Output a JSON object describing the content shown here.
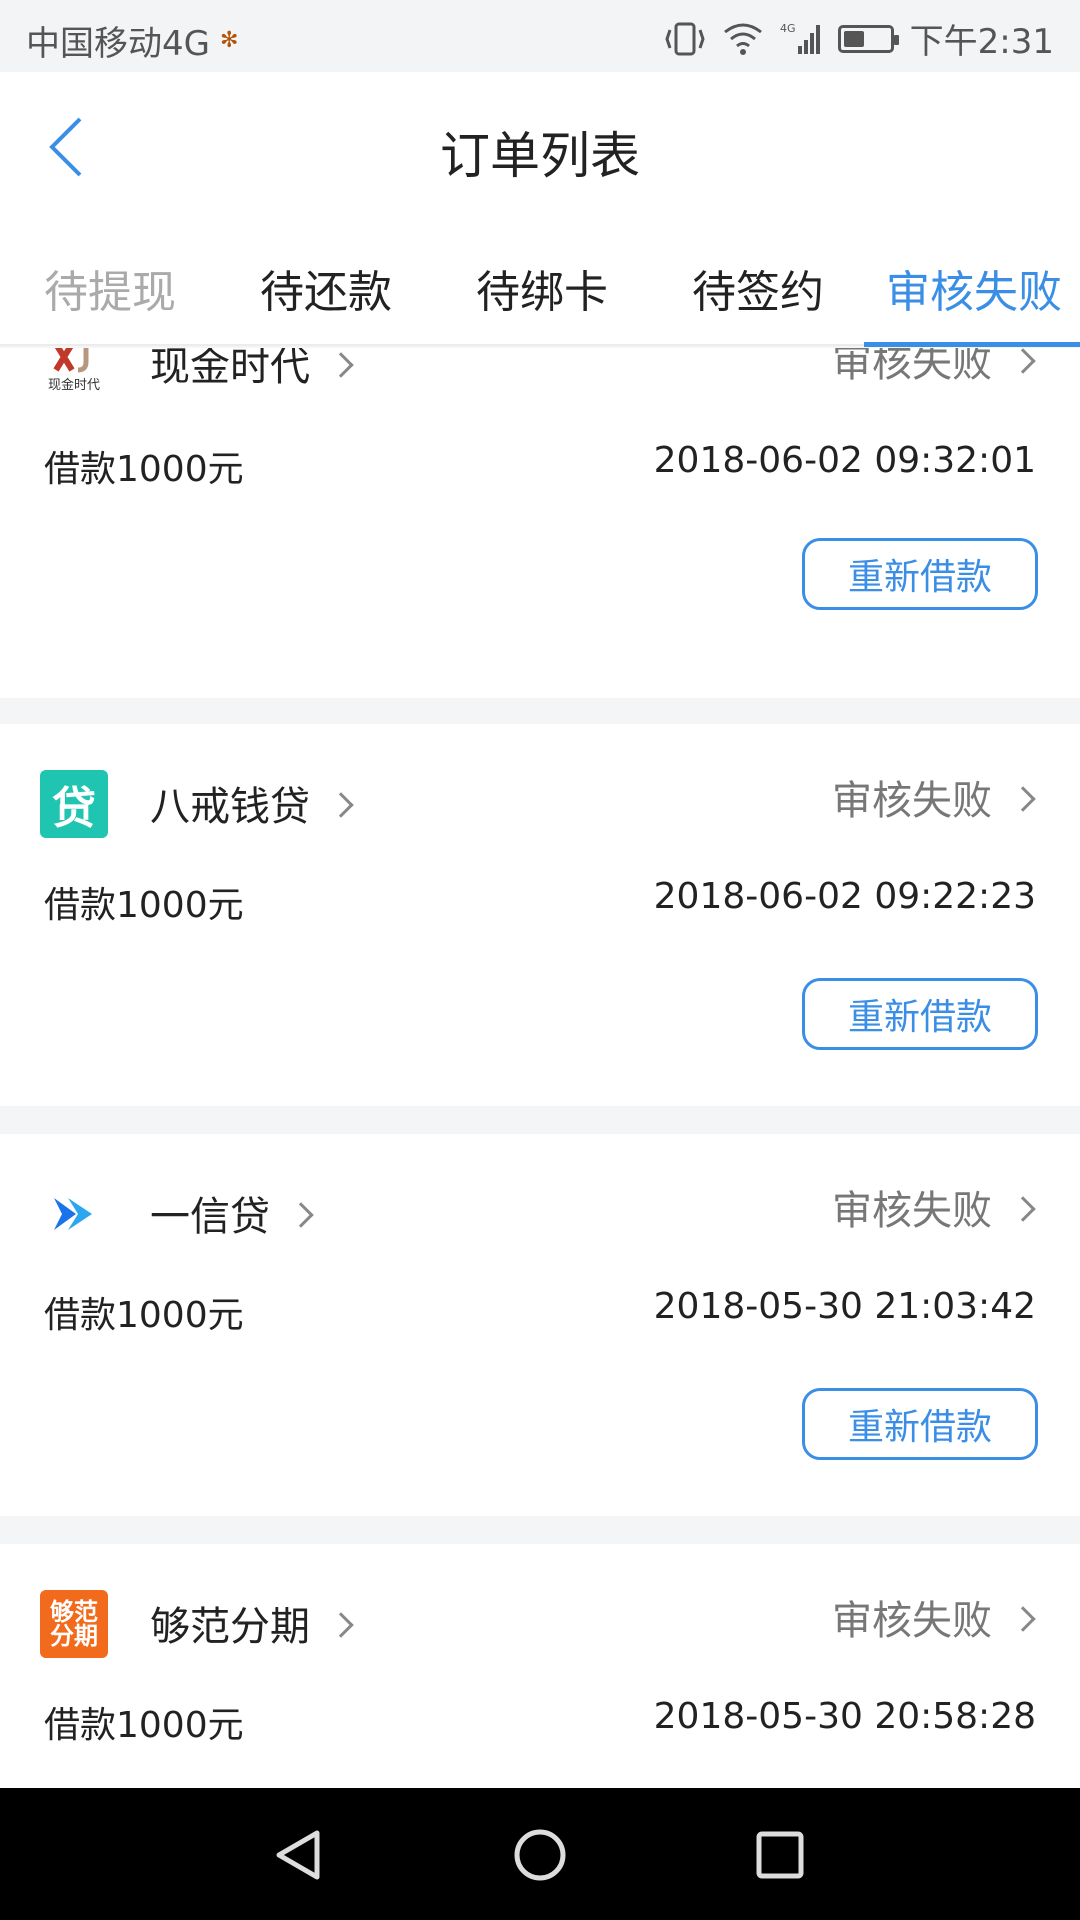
{
  "statusbar": {
    "carrier": "中国移动4G",
    "time": "下午2:31",
    "network_label": "4G"
  },
  "header": {
    "title": "订单列表"
  },
  "tabs": [
    {
      "label": "待提现"
    },
    {
      "label": "待还款"
    },
    {
      "label": "待绑卡"
    },
    {
      "label": "待签约"
    },
    {
      "label": "审核失败",
      "active": true
    }
  ],
  "orders": [
    {
      "lender": "现金时代",
      "logo_text": "现金时代",
      "status": "审核失败",
      "loan": "借款1000元",
      "date": "2018-06-02 09:32:01",
      "button": "重新借款"
    },
    {
      "lender": "八戒钱贷",
      "logo_text": "贷",
      "status": "审核失败",
      "loan": "借款1000元",
      "date": "2018-06-02 09:22:23",
      "button": "重新借款"
    },
    {
      "lender": "一信贷",
      "status": "审核失败",
      "loan": "借款1000元",
      "date": "2018-05-30 21:03:42",
      "button": "重新借款"
    },
    {
      "lender": "够范分期",
      "logo_text_1": "够范",
      "logo_text_2": "分期",
      "status": "审核失败",
      "loan": "借款1000元",
      "date": "2018-05-30 20:58:28"
    }
  ],
  "colors": {
    "accent": "#3a8ee6",
    "logo_bajie": "#1fc5b0",
    "logo_goufan": "#f26a1b",
    "logo_yixin": "#1a73e8"
  }
}
